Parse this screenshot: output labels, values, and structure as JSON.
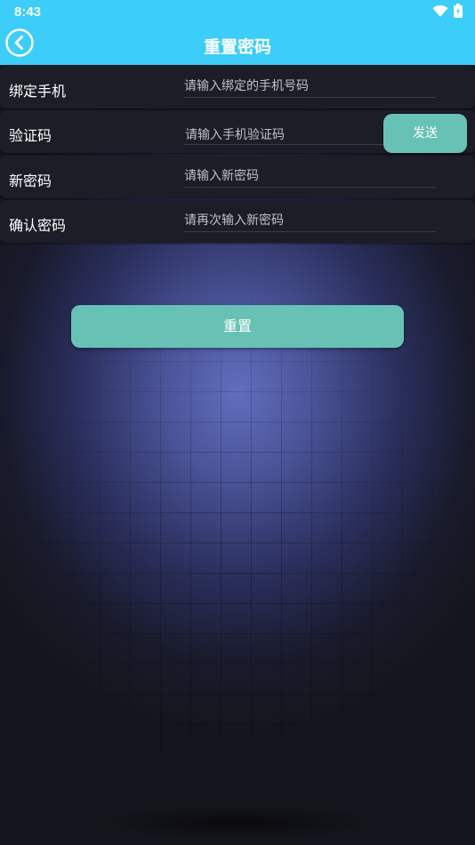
{
  "status_bar": {
    "time": "8:43",
    "icons": [
      "wifi-icon",
      "battery-icon"
    ]
  },
  "header": {
    "title": "重置密码",
    "back_icon": "chevron-left-icon",
    "background_color": "#3ccdf8"
  },
  "form": {
    "rows": [
      {
        "label": "绑定手机",
        "placeholder": "请输入绑定的手机号码",
        "value": ""
      },
      {
        "label": "验证码",
        "placeholder": "请输入手机验证码",
        "value": ""
      },
      {
        "label": "新密码",
        "placeholder": "请输入新密码",
        "value": ""
      },
      {
        "label": "确认密码",
        "placeholder": "请再次输入新密码",
        "value": ""
      }
    ],
    "send_button": "发送",
    "submit_button": "重置"
  },
  "colors": {
    "accent": "#68c1b5",
    "row_background": "#1c1d27"
  }
}
